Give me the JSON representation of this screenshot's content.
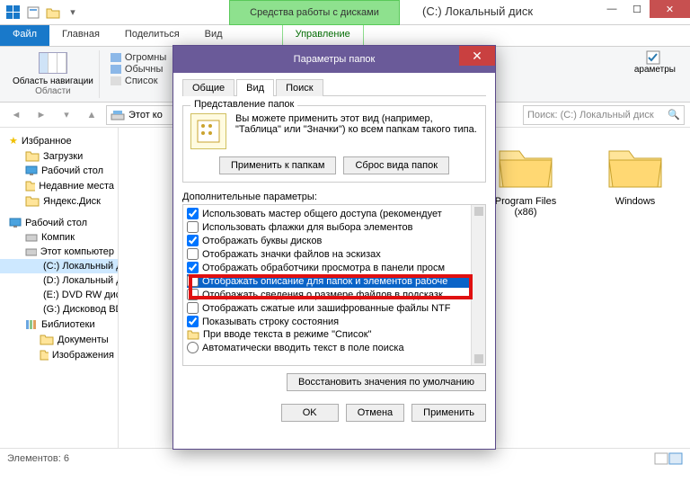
{
  "window": {
    "tools_label": "Средства работы с дисками",
    "title": "(C:) Локальный диск"
  },
  "ribbon_tabs": {
    "file": "Файл",
    "home": "Главная",
    "share": "Поделиться",
    "view": "Вид",
    "manage": "Управление"
  },
  "ribbon": {
    "nav_area": "Область навигации",
    "group_areas": "Области",
    "huge": "Огромны",
    "regular": "Обычны",
    "list": "Список",
    "params": "араметры"
  },
  "address": {
    "path": "Этот ко",
    "search_placeholder": "Поиск: (C:) Локальный диск"
  },
  "tree": {
    "favorites": "Избранное",
    "downloads": "Загрузки",
    "desktop_f": "Рабочий стол",
    "recent": "Недавние места",
    "yandex": "Яндекс.Диск",
    "desktop": "Рабочий стол",
    "kompik": "Компик",
    "thispc": "Этот компьютер",
    "c": "(C:) Локальный диск",
    "d": "(D:) Локальный диск",
    "e": "(E:) DVD RW дисковод",
    "g": "(G:) Дисковод BD-ROM",
    "libs": "Библиотеки",
    "docs": "Документы",
    "images": "Изображения"
  },
  "folders": {
    "pf": "Program Files (x86)",
    "win": "Windows"
  },
  "status": {
    "count": "Элементов: 6"
  },
  "dialog": {
    "title": "Параметры папок",
    "tabs": {
      "general": "Общие",
      "view": "Вид",
      "search": "Поиск"
    },
    "folder_views": {
      "legend": "Представление папок",
      "text": "Вы можете применить этот вид (например, \"Таблица\" или \"Значки\") ко всем папкам такого типа.",
      "apply": "Применить к папкам",
      "reset": "Сброс вида папок"
    },
    "adv_label": "Дополнительные параметры:",
    "adv": [
      {
        "c": true,
        "t": "Использовать мастер общего доступа (рекомендует"
      },
      {
        "c": false,
        "t": "Использовать флажки для выбора элементов"
      },
      {
        "c": true,
        "t": "Отображать буквы дисков"
      },
      {
        "c": false,
        "t": "Отображать значки файлов на эскизах"
      },
      {
        "c": true,
        "t": "Отображать обработчики просмотра в панели просм"
      },
      {
        "c": false,
        "t": "Отображать описание для папок и элементов рабоче",
        "hl": true
      },
      {
        "c": false,
        "t": "Отображать сведения о размере файлов в подсказк"
      },
      {
        "c": false,
        "t": "Отображать сжатые или зашифрованные файлы NTF"
      },
      {
        "c": true,
        "t": "Показывать строку состояния"
      },
      {
        "c": null,
        "t": "При вводе текста в режиме \"Список\"",
        "icon": "folder"
      },
      {
        "c": null,
        "t": "Автоматически вводить текст в поле поиска",
        "icon": "radio"
      }
    ],
    "restore": "Восстановить значения по умолчанию",
    "ok": "OK",
    "cancel": "Отмена",
    "apply": "Применить"
  }
}
